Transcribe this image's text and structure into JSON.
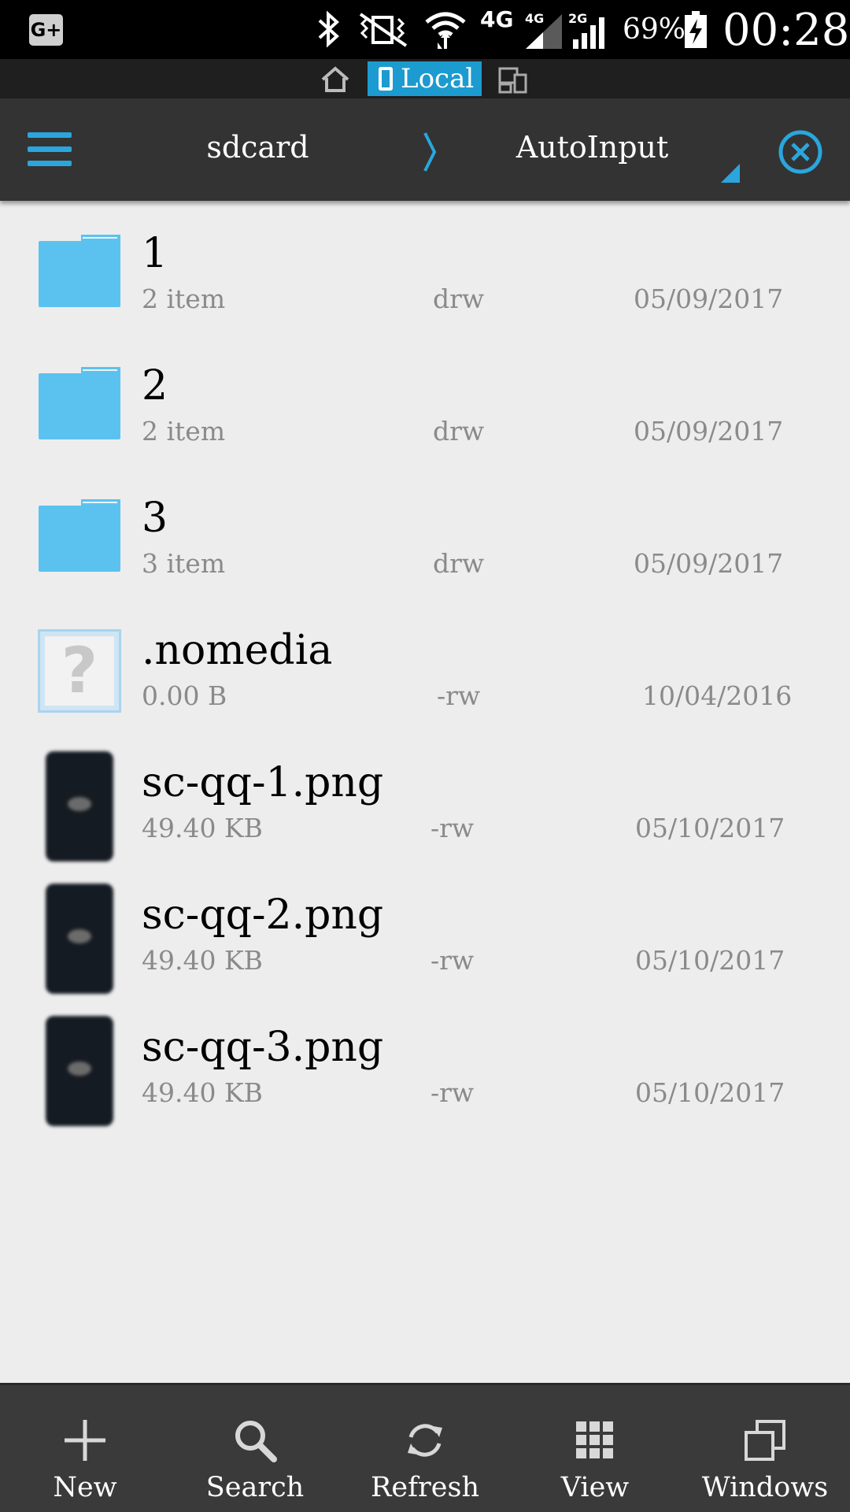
{
  "status_bar": {
    "network_4g": "4G",
    "network_4g_small": "4G",
    "network_2g_small": "2G",
    "battery": "69%",
    "time": "00:28",
    "icons": [
      "google-plus-icon",
      "bluetooth-icon",
      "vibrate-icon",
      "wifi-icon",
      "signal-icon",
      "battery-charging-icon"
    ]
  },
  "location_bar": {
    "local_label": "Local"
  },
  "header": {
    "crumb_root": "sdcard",
    "crumb_current": "AutoInput"
  },
  "files": [
    {
      "name": "1",
      "size": "2 item",
      "perm": "drw",
      "date": "05/09/2017",
      "type": "folder"
    },
    {
      "name": "2",
      "size": "2 item",
      "perm": "drw",
      "date": "05/09/2017",
      "type": "folder"
    },
    {
      "name": "3",
      "size": "3 item",
      "perm": "drw",
      "date": "05/09/2017",
      "type": "folder"
    },
    {
      "name": ".nomedia",
      "size": "0.00 B",
      "perm": "-rw",
      "date": "10/04/2016",
      "type": "unknown"
    },
    {
      "name": "sc-qq-1.png",
      "size": "49.40 KB",
      "perm": "-rw",
      "date": "05/10/2017",
      "type": "image"
    },
    {
      "name": "sc-qq-2.png",
      "size": "49.40 KB",
      "perm": "-rw",
      "date": "05/10/2017",
      "type": "image"
    },
    {
      "name": "sc-qq-3.png",
      "size": "49.40 KB",
      "perm": "-rw",
      "date": "05/10/2017",
      "type": "image"
    }
  ],
  "toolbar": {
    "new": "New",
    "search": "Search",
    "refresh": "Refresh",
    "view": "View",
    "windows": "Windows"
  },
  "colors": {
    "accent": "#2aa6dd",
    "folder": "#5bc2f0",
    "header_bg": "#333333",
    "toolbar_bg": "#3a3a3a"
  }
}
